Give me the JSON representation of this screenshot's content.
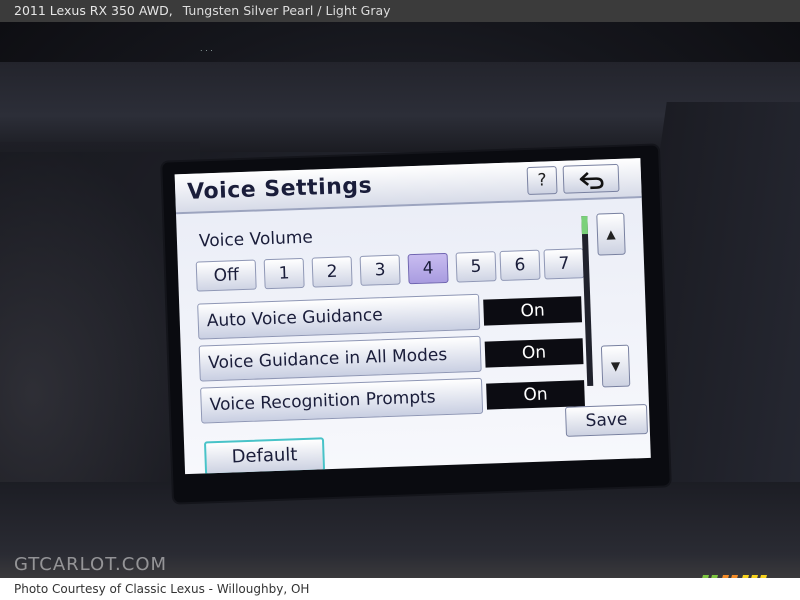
{
  "header": {
    "title": "2011 Lexus RX 350 AWD,",
    "subtitle": "Tungsten Silver Pearl / Light Gray"
  },
  "footer": {
    "credit": "Photo Courtesy of Classic Lexus - Willoughby, OH"
  },
  "watermark": {
    "text": "GTCARLOT.COM"
  },
  "screen": {
    "title": "Voice Settings",
    "help_label": "?",
    "back_icon": "return-arrow-icon",
    "volume": {
      "label": "Voice Volume",
      "options": [
        "Off",
        "1",
        "2",
        "3",
        "4",
        "5",
        "6",
        "7"
      ],
      "selected": "4"
    },
    "settings": [
      {
        "label": "Auto Voice Guidance",
        "value": "On"
      },
      {
        "label": "Voice Guidance in All Modes",
        "value": "On"
      },
      {
        "label": "Voice Recognition Prompts",
        "value": "On"
      }
    ],
    "scroll_up_icon": "scroll-up-icon",
    "scroll_down_icon": "scroll-down-icon",
    "save_label": "Save",
    "default_label": "Default"
  },
  "colors": {
    "accent_selected": "#a99ce0",
    "default_border": "#48c3c8",
    "value_bg": "#0c0c12",
    "logo_green": "#7ec542",
    "logo_orange": "#f28c28",
    "logo_yellow": "#f6d21e"
  }
}
